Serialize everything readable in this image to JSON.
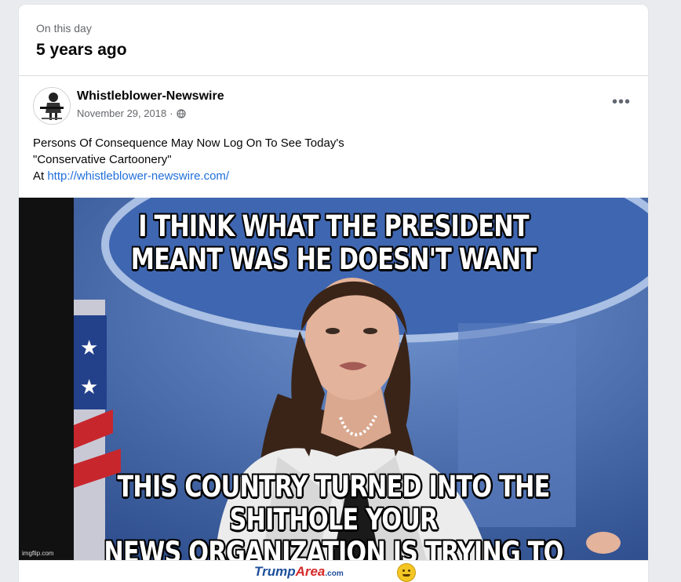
{
  "on_this_day": {
    "label": "On this day",
    "years_ago": "5 years ago"
  },
  "post": {
    "author": "Whistleblower-Newswire",
    "date": "November 29, 2018",
    "separator": "·",
    "privacy_icon": "globe-icon",
    "more_label": "•••",
    "text_line1": "Persons Of Consequence May Now Log On To See Today's",
    "text_line2": "\"Conservative Cartoonery\"",
    "text_line3_prefix": "At ",
    "link": "http://whistleblower-newswire.com/"
  },
  "meme": {
    "top_line1": "I THINK WHAT THE PRESIDENT",
    "top_line2": "MEANT WAS HE DOESN'T WANT",
    "bottom_line1": "THIS COUNTRY TURNED INTO THE SHITHOLE YOUR",
    "bottom_line2": "NEWS ORGANIZATION IS TRYING TO TURN IT INTO",
    "watermark": "imgflip.com"
  },
  "footer": {
    "brand_a": "Trump",
    "brand_b": "Area",
    "brand_c": ".com",
    "emoji_icon": "smiley-emoji-icon"
  },
  "colors": {
    "link": "#216fdb",
    "brand_blue": "#1d4f9c",
    "brand_red": "#d72a2a"
  }
}
